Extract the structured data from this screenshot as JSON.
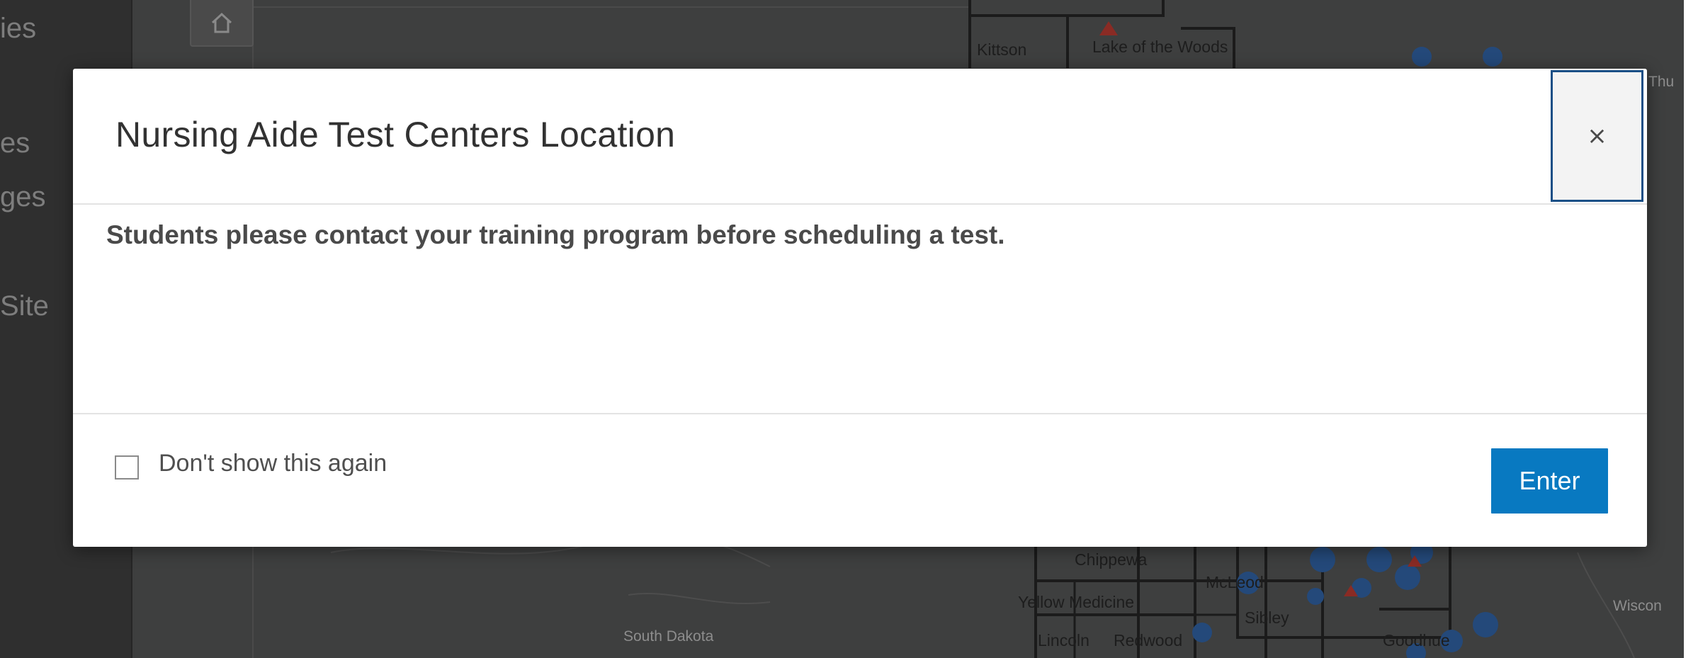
{
  "background": {
    "sidebar_items": [
      "ies",
      "es",
      "ges",
      "Site"
    ],
    "map_labels": {
      "kittson": "Kittson",
      "lake_of_the_woods": "Lake of the Woods",
      "thu": "Thu",
      "chippewa": "Chippewa",
      "yellow_medicine": "Yellow Medicine",
      "mcleod": "McLeod",
      "sibley": "Sibley",
      "lincoln": "Lincoln",
      "redwood": "Redwood",
      "goodhue": "Goodhue",
      "south_dakota": "South Dakota",
      "wiscon": "Wiscon"
    }
  },
  "modal": {
    "title": "Nursing Aide Test Centers Location",
    "close_label": "×",
    "message": "Students please contact your training program before scheduling a test.",
    "checkbox_label": "Don't show this again",
    "checkbox_checked": false,
    "enter_label": "Enter"
  },
  "colors": {
    "accent": "#0879c1",
    "close_focus_border": "#1a4f86",
    "overlay": "#3e3f3f"
  }
}
